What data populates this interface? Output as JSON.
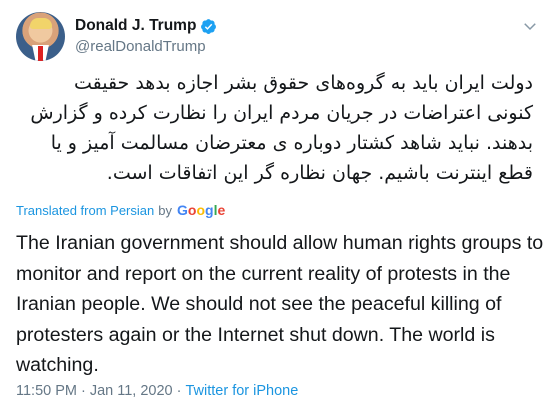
{
  "author": {
    "display_name": "Donald J. Trump",
    "handle": "@realDonaldTrump",
    "verified": true
  },
  "tweet": {
    "original_text": "دولت ایران باید به گروه‌های حقوق بشر اجازه بدهد حقیقت کنونی اعتراضات در جریان مردم ایران را نظارت کرده و گزارش بدهند. نباید شاهد کشتار دوباره ی معترضان مسالمت آمیز و یا قطع اینترنت باشیم. جهان نظاره گر این اتفاقات است.",
    "translation_label": "Translated from Persian",
    "translation_by": "by",
    "translation_provider": "Google",
    "translated_text": "The Iranian government should allow human rights groups to monitor and report on the current reality of protests in the Iranian people. We should not see the peaceful killing of protesters again or the Internet shut down. The world is watching."
  },
  "meta": {
    "time": "11:50 PM",
    "separator": "·",
    "date": "Jan 11, 2020",
    "source": "Twitter for iPhone"
  },
  "colors": {
    "link": "#1b95e0",
    "secondary_text": "#657786",
    "primary_text": "#14171a",
    "verified_badge": "#1da1f2"
  },
  "icons": [
    "verified-badge-icon",
    "chevron-down-icon"
  ]
}
